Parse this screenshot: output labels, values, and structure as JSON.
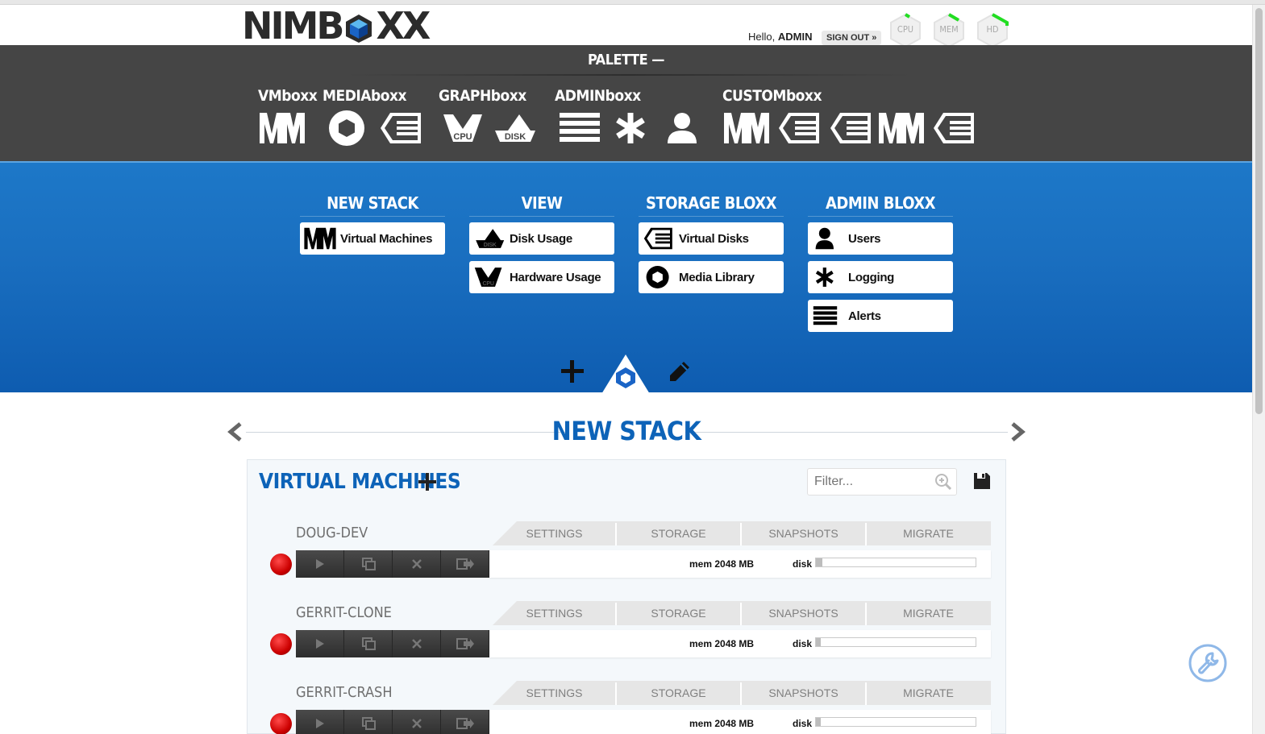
{
  "header": {
    "logo_text": "NIMBOXX",
    "hello_label": "Hello,",
    "user": "ADMIN",
    "signout_label": "SIGN OUT »",
    "gauges": [
      "CPU",
      "MEM",
      "HD"
    ]
  },
  "palette": {
    "title": "PALETTE —",
    "categories": [
      "VMboxx",
      "MEDIAboxx",
      "GRAPHboxx",
      "ADMINboxx",
      "CUSTOMboxx"
    ],
    "icon_labels": {
      "cpu": "CPU",
      "disk": "DISK",
      "vm": "VM"
    }
  },
  "blocks": {
    "columns": [
      {
        "title": "NEW STACK",
        "items": [
          "Virtual Machines"
        ]
      },
      {
        "title": "VIEW",
        "items": [
          "Disk Usage",
          "Hardware Usage"
        ]
      },
      {
        "title": "STORAGE BLOXX",
        "items": [
          "Virtual Disks",
          "Media Library"
        ]
      },
      {
        "title": "ADMIN BLOXX",
        "items": [
          "Users",
          "Logging",
          "Alerts"
        ]
      }
    ]
  },
  "stack": {
    "title": "NEW STACK",
    "panel_title": "VIRTUAL MACHINES",
    "filter_placeholder": "Filter...",
    "tabs": [
      "SETTINGS",
      "STORAGE",
      "SNAPSHOTS",
      "MIGRATE"
    ],
    "vms": [
      {
        "name": "DOUG-DEV",
        "mem": "mem 2048 MB",
        "disk_label": "disk",
        "disk_used": 0.04,
        "status_color": "#cc0000"
      },
      {
        "name": "GERRIT-CLONE",
        "mem": "mem 2048 MB",
        "disk_label": "disk",
        "disk_used": 0.03,
        "status_color": "#cc0000"
      },
      {
        "name": "GERRIT-CRASH",
        "mem": "mem 2048 MB",
        "disk_label": "disk",
        "disk_used": 0.03,
        "status_color": "#cc0000"
      }
    ]
  },
  "colors": {
    "brand_blue": "#0d63b8",
    "palette_bg": "#454545",
    "status_stopped": "#cc0000",
    "gauge_ok": "#22dd22"
  }
}
